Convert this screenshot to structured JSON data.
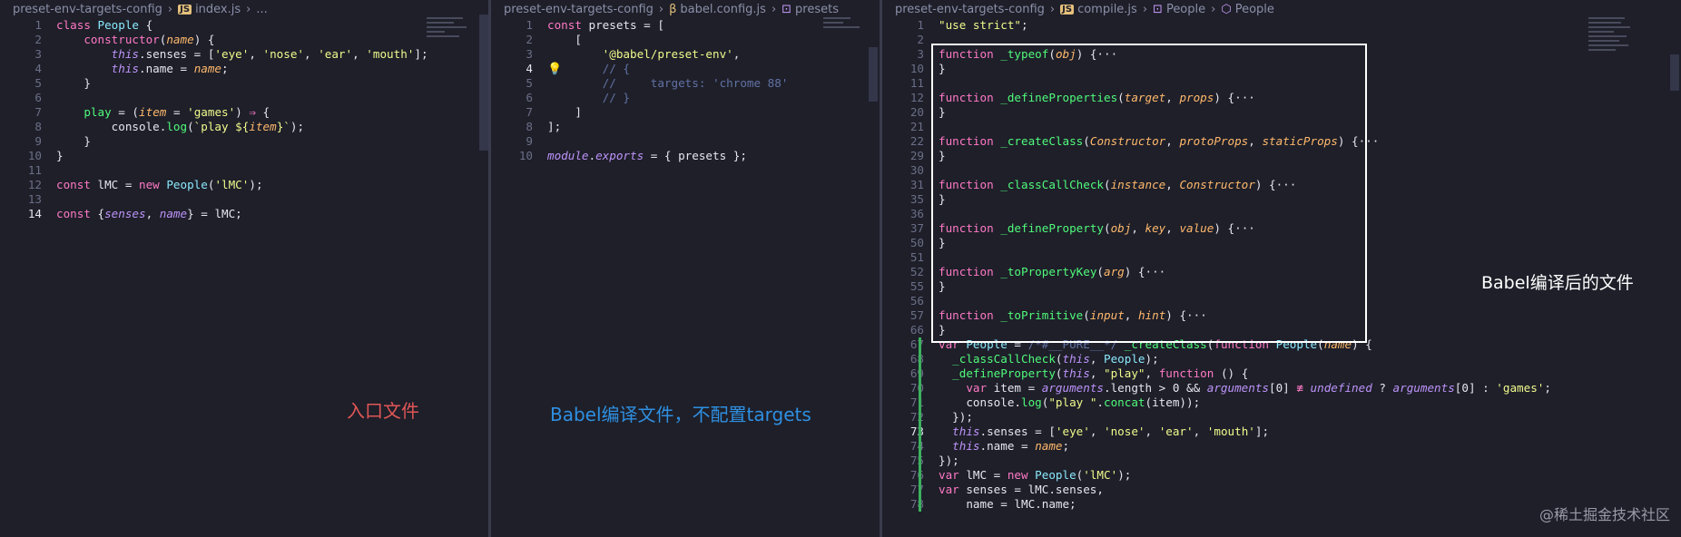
{
  "panes": [
    {
      "breadcrumb": {
        "folder": "preset-env-targets-config",
        "file": "index.js",
        "symbol": "..."
      },
      "current_line": 14,
      "lines": [
        {
          "n": "1",
          "html": "<span class='k'>class</span> <span class='cls'>People</span> {"
        },
        {
          "n": "2",
          "html": "    <span class='k'>constructor</span>(<span class='p'>name</span>) {"
        },
        {
          "n": "3",
          "html": "        <span class='t'>this</span>.senses = [<span class='s'>'eye'</span>, <span class='s'>'nose'</span>, <span class='s'>'ear'</span>, <span class='s'>'mouth'</span>];"
        },
        {
          "n": "4",
          "html": "        <span class='t'>this</span>.name = <span class='p'>name</span>;"
        },
        {
          "n": "5",
          "html": "    }"
        },
        {
          "n": "6",
          "html": ""
        },
        {
          "n": "7",
          "html": "    <span class='f'>play</span> = (<span class='p'>item</span> = <span class='s'>'games'</span>) <span class='k'>⇒</span> {"
        },
        {
          "n": "8",
          "html": "        console.<span class='f'>log</span>(<span class='s'>`play ${</span><span class='p'>item</span><span class='s'>}`</span>);"
        },
        {
          "n": "9",
          "html": "    }"
        },
        {
          "n": "10",
          "html": "}"
        },
        {
          "n": "11",
          "html": ""
        },
        {
          "n": "12",
          "html": "<span class='k'>const</span> lMC = <span class='k'>new</span> <span class='cls'>People</span>(<span class='s'>'lMC'</span>);"
        },
        {
          "n": "13",
          "html": ""
        },
        {
          "n": "14",
          "html": "<span class='k'>const</span> {<span class='t'>senses</span>, <span class='t'>name</span>} = lMC;"
        }
      ]
    },
    {
      "breadcrumb": {
        "folder": "preset-env-targets-config",
        "file": "babel.config.js",
        "symbol": "presets"
      },
      "current_line": 4,
      "lines": [
        {
          "n": "1",
          "html": "<span class='k'>const</span> presets = ["
        },
        {
          "n": "2",
          "html": "    ["
        },
        {
          "n": "3",
          "html": "        <span class='s'>'@babel/preset-env'</span>,"
        },
        {
          "n": "4",
          "html": "        <span class='c'>// {</span>"
        },
        {
          "n": "5",
          "html": "        <span class='c'>//     targets: 'chrome 88'</span>"
        },
        {
          "n": "6",
          "html": "        <span class='c'>// }</span>"
        },
        {
          "n": "7",
          "html": "    ]"
        },
        {
          "n": "8",
          "html": "];"
        },
        {
          "n": "9",
          "html": ""
        },
        {
          "n": "10",
          "html": "<span class='t'>module</span>.<span class='t'>exports</span> = { presets };"
        }
      ]
    },
    {
      "breadcrumb": {
        "folder": "preset-env-targets-config",
        "file": "compile.js",
        "symbol1": "People",
        "symbol2": "People"
      },
      "current_line": 73,
      "lines": [
        {
          "n": "1",
          "html": "<span class='s'>\"use strict\"</span>;"
        },
        {
          "n": "2",
          "html": ""
        },
        {
          "n": "3",
          "html": "<span class='k'>function</span> <span class='f'>_typeof</span>(<span class='p'>obj</span>) {···"
        },
        {
          "n": "10",
          "html": "}"
        },
        {
          "n": "11",
          "html": ""
        },
        {
          "n": "12",
          "html": "<span class='k'>function</span> <span class='f'>_defineProperties</span>(<span class='p'>target</span>, <span class='p'>props</span>) {···"
        },
        {
          "n": "20",
          "html": "}"
        },
        {
          "n": "21",
          "html": ""
        },
        {
          "n": "22",
          "html": "<span class='k'>function</span> <span class='f'>_createClass</span>(<span class='p'>Constructor</span>, <span class='p'>protoProps</span>, <span class='p'>staticProps</span>) {···"
        },
        {
          "n": "29",
          "html": "}"
        },
        {
          "n": "30",
          "html": ""
        },
        {
          "n": "31",
          "html": "<span class='k'>function</span> <span class='f'>_classCallCheck</span>(<span class='p'>instance</span>, <span class='p'>Constructor</span>) {···"
        },
        {
          "n": "35",
          "html": "}"
        },
        {
          "n": "36",
          "html": ""
        },
        {
          "n": "37",
          "html": "<span class='k'>function</span> <span class='f'>_defineProperty</span>(<span class='p'>obj</span>, <span class='p'>key</span>, <span class='p'>value</span>) {···"
        },
        {
          "n": "50",
          "html": "}"
        },
        {
          "n": "51",
          "html": ""
        },
        {
          "n": "52",
          "html": "<span class='k'>function</span> <span class='f'>_toPropertyKey</span>(<span class='p'>arg</span>) {···"
        },
        {
          "n": "55",
          "html": "}"
        },
        {
          "n": "56",
          "html": ""
        },
        {
          "n": "57",
          "html": "<span class='k'>function</span> <span class='f'>_toPrimitive</span>(<span class='p'>input</span>, <span class='p'>hint</span>) {···"
        },
        {
          "n": "66",
          "html": "}"
        },
        {
          "n": "67",
          "html": "<span class='k'>var</span> <span class='cls'>People</span> = <span class='c'>/*#__PURE__*/</span> <span class='f'>_createClass</span>(<span class='k'>function</span> <span class='cls'>People</span>(<span class='p'>name</span>) {"
        },
        {
          "n": "68",
          "html": "  <span class='f'>_classCallCheck</span>(<span class='t'>this</span>, <span class='cls'>People</span>);"
        },
        {
          "n": "69",
          "html": "  <span class='f'>_defineProperty</span>(<span class='t'>this</span>, <span class='s'>\"play\"</span>, <span class='k'>function</span> () {"
        },
        {
          "n": "70",
          "html": "    <span class='k'>var</span> item = <span class='t'>arguments</span>.length > 0 && <span class='t'>arguments</span>[0] <span class='k'>≢</span> <span class='t'>undefined</span> ? <span class='t'>arguments</span>[0] : <span class='s'>'games'</span>;"
        },
        {
          "n": "71",
          "html": "    console.<span class='f'>log</span>(<span class='s'>\"play \"</span>.<span class='f'>concat</span>(item));"
        },
        {
          "n": "72",
          "html": "  });"
        },
        {
          "n": "73",
          "html": "  <span class='t'>this</span>.senses = [<span class='s'>'eye'</span>, <span class='s'>'nose'</span>, <span class='s'>'ear'</span>, <span class='s'>'mouth'</span>];"
        },
        {
          "n": "74",
          "html": "  <span class='t'>this</span>.name = <span class='p'>name</span>;"
        },
        {
          "n": "75",
          "html": "});"
        },
        {
          "n": "76",
          "html": "<span class='k'>var</span> lMC = <span class='k'>new</span> <span class='cls'>People</span>(<span class='s'>'lMC'</span>);"
        },
        {
          "n": "77",
          "html": "<span class='k'>var</span> senses = lMC.senses,"
        },
        {
          "n": "78",
          "html": "    name = lMC.name;"
        }
      ]
    }
  ],
  "captions": {
    "entry": "入口文件",
    "config": "Babel编译文件，不配置targets",
    "output": "Babel编译后的文件"
  },
  "watermark": "@稀土掘金技术社区",
  "colors": {
    "keyword": "#ff79c6",
    "function": "#50fa7b",
    "string": "#f1fa8c",
    "param": "#ffb86c",
    "caption_red": "#e05656",
    "caption_blue": "#2f8fe0"
  }
}
